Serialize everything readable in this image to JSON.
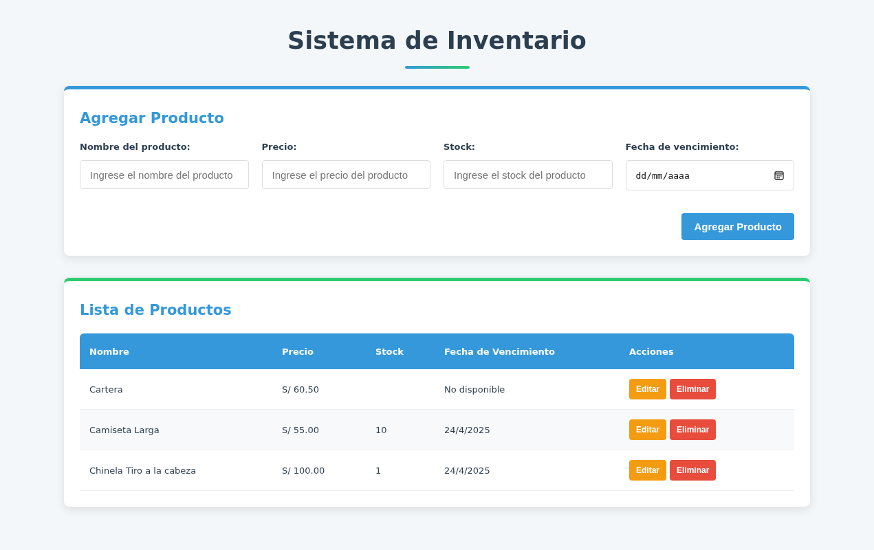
{
  "title": "Sistema de Inventario",
  "form": {
    "heading": "Agregar Producto",
    "fields": [
      {
        "kind": "text",
        "label": "Nombre del producto:",
        "placeholder": "Ingrese el nombre del producto"
      },
      {
        "kind": "text",
        "label": "Precio:",
        "placeholder": "Ingrese el precio del producto"
      },
      {
        "kind": "text",
        "label": "Stock:",
        "placeholder": "Ingrese el stock del producto"
      },
      {
        "kind": "date",
        "label": "Fecha de vencimiento:",
        "value": "dd/mm/aaaa"
      }
    ],
    "button": "Agregar Producto"
  },
  "table": {
    "heading": "Lista de Productos",
    "columns": [
      "Nombre",
      "Precio",
      "Stock",
      "Fecha de Vencimiento",
      "Acciones"
    ],
    "rows": [
      {
        "name": "Cartera",
        "price": "S/ 60.50",
        "expiry": "No disponible",
        "actions": [
          {
            "kind": "edit",
            "label": "Editar"
          },
          {
            "kind": "delete",
            "label": "Eliminar"
          }
        ]
      },
      {
        "name": "Camiseta Larga",
        "price": "S/ 55.00",
        "stock": "10",
        "expiry": "24/4/2025",
        "actions": [
          {
            "kind": "edit",
            "label": "Editar"
          },
          {
            "kind": "delete",
            "label": "Eliminar"
          }
        ]
      },
      {
        "name": "Chinela Tiro a la cabeza",
        "price": "S/ 100.00",
        "stock": "1",
        "expiry": "24/4/2025",
        "actions": [
          {
            "kind": "edit",
            "label": "Editar"
          },
          {
            "kind": "delete",
            "label": "Eliminar"
          }
        ]
      }
    ]
  }
}
